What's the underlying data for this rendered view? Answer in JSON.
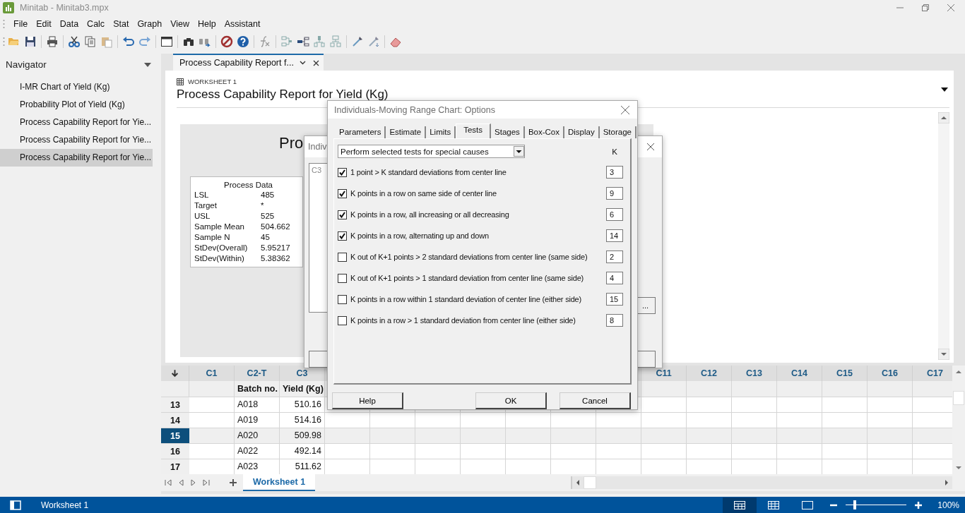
{
  "window": {
    "title": "Minitab - Minitab3.mpx"
  },
  "menu": [
    "File",
    "Edit",
    "Data",
    "Calc",
    "Stat",
    "Graph",
    "View",
    "Help",
    "Assistant"
  ],
  "navigator": {
    "title": "Navigator",
    "items": [
      {
        "label": "I-MR Chart of Yield (Kg)",
        "selected": false
      },
      {
        "label": "Probability Plot of Yield (Kg)",
        "selected": false
      },
      {
        "label": "Process Capability Report for Yie...",
        "selected": false
      },
      {
        "label": "Process Capability Report for Yie...",
        "selected": false
      },
      {
        "label": "Process Capability Report for Yie...",
        "selected": true
      }
    ]
  },
  "document_tab": {
    "label": "Process Capability Report f..."
  },
  "output": {
    "worksheet": "WORKSHEET 1",
    "title": "Process Capability Report for Yield (Kg)",
    "report_title": "Pro",
    "process_data": {
      "title": "Process Data",
      "rows": [
        [
          "LSL",
          "485"
        ],
        [
          "Target",
          "*"
        ],
        [
          "USL",
          "525"
        ],
        [
          "Sample Mean",
          "504.662"
        ],
        [
          "Sample N",
          "45"
        ],
        [
          "StDev(Overall)",
          "5.95217"
        ],
        [
          "StDev(Within)",
          "5.38362"
        ]
      ]
    }
  },
  "back_dialog": {
    "title": "Indiv",
    "list_item": "C3",
    "button": "..."
  },
  "options_dialog": {
    "title": "Individuals-Moving Range Chart: Options",
    "tabs": [
      {
        "label": "Parameters",
        "selected": false
      },
      {
        "label": "Estimate",
        "selected": false
      },
      {
        "label": "Limits",
        "selected": false
      },
      {
        "label": "Tests",
        "selected": true
      },
      {
        "label": "Stages",
        "selected": false
      },
      {
        "label": "Box-Cox",
        "selected": false
      },
      {
        "label": "Display",
        "selected": false
      },
      {
        "label": "Storage",
        "selected": false
      }
    ],
    "mode": "Perform selected tests for special causes",
    "k_header": "K",
    "tests": [
      {
        "label": "1 point > K standard deviations from center line",
        "checked": true,
        "k": "3"
      },
      {
        "label": "K points in a row on same side of center line",
        "checked": true,
        "k": "9"
      },
      {
        "label": "K points in a row, all increasing or all decreasing",
        "checked": true,
        "k": "6"
      },
      {
        "label": "K points in a row, alternating up and down",
        "checked": true,
        "k": "14"
      },
      {
        "label": "K out of K+1 points > 2 standard deviations from center line (same side)",
        "checked": false,
        "k": "2"
      },
      {
        "label": "K out of K+1 points > 1 standard deviation from center line (same side)",
        "checked": false,
        "k": "4"
      },
      {
        "label": "K points in a row within 1 standard deviation of center line (either side)",
        "checked": false,
        "k": "15"
      },
      {
        "label": "K points in a row > 1 standard deviation from center line (either side)",
        "checked": false,
        "k": "8"
      }
    ],
    "buttons": [
      "Help",
      "OK",
      "Cancel"
    ]
  },
  "worksheet": {
    "left_columns": [
      {
        "label": "C1"
      },
      {
        "label": "C2-T",
        "name": "Batch no."
      },
      {
        "label": "C3",
        "name": "Yield (Kg)"
      }
    ],
    "right_columns": [
      "C11",
      "C12",
      "C13",
      "C14",
      "C15",
      "C16",
      "C17"
    ],
    "rows": [
      {
        "number": "13",
        "cells": [
          null,
          "A018",
          "510.16"
        ],
        "selected": false
      },
      {
        "number": "14",
        "cells": [
          null,
          "A019",
          "514.16"
        ],
        "selected": false
      },
      {
        "number": "15",
        "cells": [
          null,
          "A020",
          "509.98"
        ],
        "selected": true
      },
      {
        "number": "16",
        "cells": [
          null,
          "A022",
          "492.14"
        ],
        "selected": false
      },
      {
        "number": "17",
        "cells": [
          null,
          "A023",
          "511.62"
        ],
        "selected": false
      }
    ]
  },
  "sheet_tab": {
    "label": "Worksheet 1"
  },
  "status_bar": {
    "label": "Worksheet 1",
    "views": [
      {
        "kind": "worksheet",
        "selected": true
      },
      {
        "kind": "grid",
        "selected": false
      },
      {
        "kind": "page",
        "selected": false
      }
    ],
    "level": 0.13,
    "zoom": "100%"
  }
}
